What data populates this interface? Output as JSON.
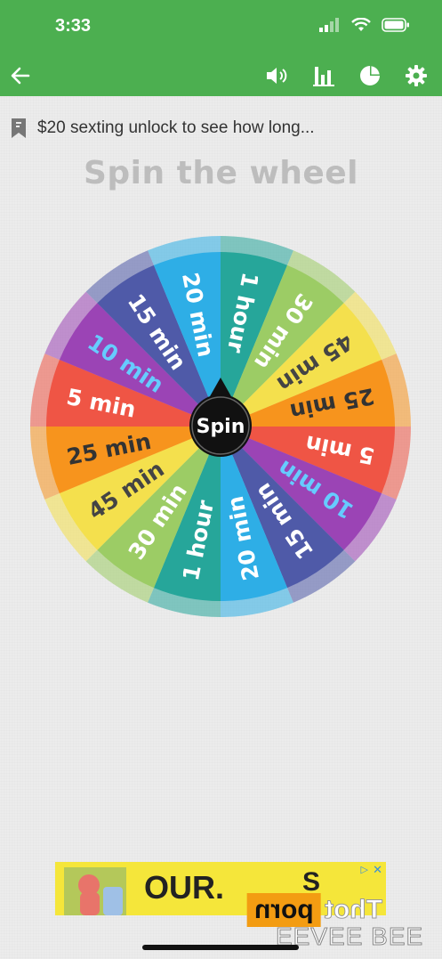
{
  "status_bar": {
    "time": "3:33"
  },
  "toolbar": {
    "back_icon": "arrow-left-icon",
    "icons": [
      "volume-icon",
      "bar-chart-icon",
      "pie-chart-icon",
      "gear-icon"
    ]
  },
  "wheel_name": "$20 sexting unlock to see how long...",
  "heading": "Spin the wheel",
  "spin_label": "Spin",
  "wheel": {
    "segments": [
      {
        "label": "1 hour",
        "color": "#26a69a",
        "text": "#ffffff"
      },
      {
        "label": "30 min",
        "color": "#9ccc65",
        "text": "#ffffff"
      },
      {
        "label": "45 min",
        "color": "#f4e04d",
        "text": "#444444"
      },
      {
        "label": "25 min",
        "color": "#f7941d",
        "text": "#333333"
      },
      {
        "label": "5 min",
        "color": "#ef5545",
        "text": "#ffffff"
      },
      {
        "label": "10 min",
        "color": "#9b44b5",
        "text": "#66ccff"
      },
      {
        "label": "15 min",
        "color": "#4f5aa8",
        "text": "#ffffff"
      },
      {
        "label": "20 min",
        "color": "#2eaee6",
        "text": "#ffffff"
      },
      {
        "label": "1 hour",
        "color": "#26a69a",
        "text": "#ffffff"
      },
      {
        "label": "30 min",
        "color": "#9ccc65",
        "text": "#ffffff"
      },
      {
        "label": "45 min",
        "color": "#f4e04d",
        "text": "#444444"
      },
      {
        "label": "25 min",
        "color": "#f7941d",
        "text": "#333333"
      },
      {
        "label": "5 min",
        "color": "#ef5545",
        "text": "#ffffff"
      },
      {
        "label": "10 min",
        "color": "#9b44b5",
        "text": "#66ccff"
      },
      {
        "label": "15 min",
        "color": "#4f5aa8",
        "text": "#ffffff"
      },
      {
        "label": "20 min",
        "color": "#2eaee6",
        "text": "#ffffff"
      }
    ]
  },
  "ad": {
    "text": "OUR.",
    "text2": "S",
    "close": "✕",
    "play": "▷"
  },
  "watermark": {
    "box": "porn",
    "text": "Thot",
    "line2": "EEVEE BEE"
  },
  "colors": {
    "primary": "#4caf50",
    "heading": "#bdbdbd"
  }
}
